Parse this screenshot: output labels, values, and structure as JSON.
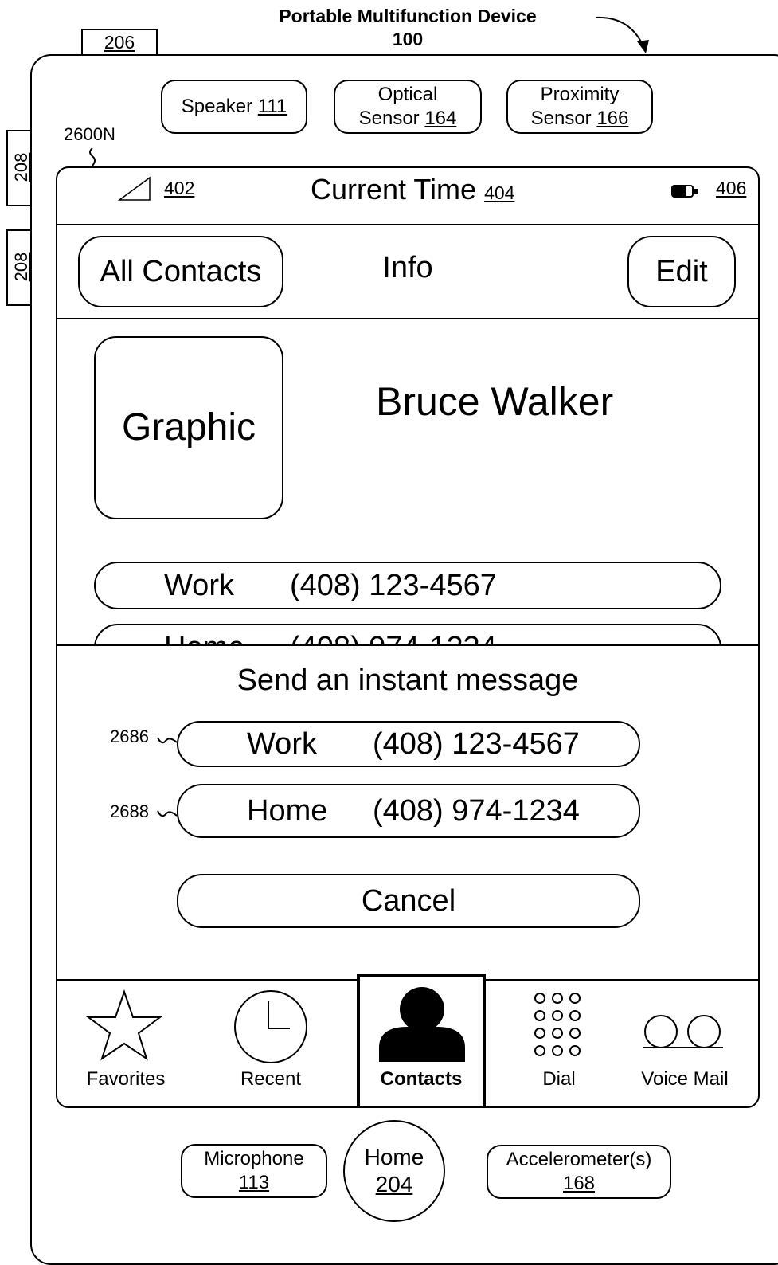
{
  "figure": {
    "title_line1": "Portable Multifunction Device",
    "title_line2": "100",
    "ref_206": "206",
    "ref_208a": "208",
    "ref_208b": "208",
    "ref_screen": "2600N",
    "ref_2686": "2686",
    "ref_2688": "2688"
  },
  "hardware": {
    "speaker": {
      "label": "Speaker",
      "ref": "111"
    },
    "optical": {
      "line1": "Optical",
      "label": "Sensor",
      "ref": "164"
    },
    "proximity": {
      "line1": "Proximity",
      "label": "Sensor",
      "ref": "166"
    },
    "microphone": {
      "label": "Microphone",
      "ref": "113"
    },
    "home": {
      "label": "Home",
      "ref": "204"
    },
    "accelerometer": {
      "label": "Accelerometer(s)",
      "ref": "168"
    }
  },
  "status_bar": {
    "signal_ref": "402",
    "time_label": "Current Time",
    "time_ref": "404",
    "battery_ref": "406"
  },
  "nav": {
    "back": "All Contacts",
    "title": "Info",
    "edit": "Edit"
  },
  "contact": {
    "graphic": "Graphic",
    "name": "Bruce Walker",
    "rows": [
      {
        "type": "Work",
        "number": "(408) 123-4567"
      },
      {
        "type": "Home",
        "number": "(408) 974-1234"
      }
    ]
  },
  "sheet": {
    "title": "Send an instant message",
    "options": [
      {
        "type": "Work",
        "number": "(408) 123-4567"
      },
      {
        "type": "Home",
        "number": "(408) 974-1234"
      }
    ],
    "cancel": "Cancel"
  },
  "tabbar": {
    "tabs": [
      {
        "label": "Favorites",
        "icon": "star-icon"
      },
      {
        "label": "Recent",
        "icon": "clock-icon"
      },
      {
        "label": "Contacts",
        "icon": "person-icon",
        "selected": true
      },
      {
        "label": "Dial",
        "icon": "keypad-icon"
      },
      {
        "label": "Voice Mail",
        "icon": "voicemail-icon"
      }
    ]
  }
}
